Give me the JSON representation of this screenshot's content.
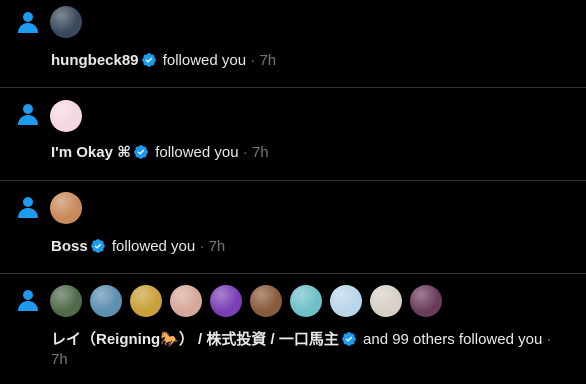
{
  "colors": {
    "background": "#000000",
    "text": "#e7e9ea",
    "muted": "#71767b",
    "accent": "#1d9bf0",
    "divider": "#2f3336"
  },
  "icons": {
    "person": "person-icon",
    "verified": "verified-badge-icon"
  },
  "notifications": [
    {
      "name": "hungbeck89",
      "verified": true,
      "action": "followed you",
      "separator": "·",
      "time": "7h",
      "avatars": [
        {
          "label": "hungbeck89 avatar",
          "color": "#3a4a5c"
        }
      ]
    },
    {
      "name": "I'm Okay ⌘",
      "verified": true,
      "action": "followed you",
      "separator": "·",
      "time": "7h",
      "avatars": [
        {
          "label": "I'm Okay avatar",
          "color": "#f5d7de"
        }
      ]
    },
    {
      "name": "Boss",
      "verified": true,
      "action": "followed you",
      "separator": "·",
      "time": "7h",
      "avatars": [
        {
          "label": "Boss avatar",
          "color": "#c98a5c"
        }
      ]
    },
    {
      "name": "レイ（Reigning🐎） / 株式投資 / 一口馬主",
      "verified": true,
      "action": "and 99 others followed you",
      "separator": "·",
      "time": "7h",
      "avatars": [
        {
          "label": "follower avatar 1",
          "color": "#4f6b4a"
        },
        {
          "label": "follower avatar 2",
          "color": "#5d8fb0"
        },
        {
          "label": "follower avatar 3",
          "color": "#c9a13a"
        },
        {
          "label": "follower avatar 4",
          "color": "#d7a89a"
        },
        {
          "label": "follower avatar 5",
          "color": "#7a3fb5"
        },
        {
          "label": "follower avatar 6",
          "color": "#8a5a3c"
        },
        {
          "label": "follower avatar 7",
          "color": "#6fc0c9"
        },
        {
          "label": "follower avatar 8",
          "color": "#b9d6ea"
        },
        {
          "label": "follower avatar 9",
          "color": "#d6d0c6"
        },
        {
          "label": "follower avatar 10",
          "color": "#6b3b5c"
        }
      ]
    }
  ]
}
